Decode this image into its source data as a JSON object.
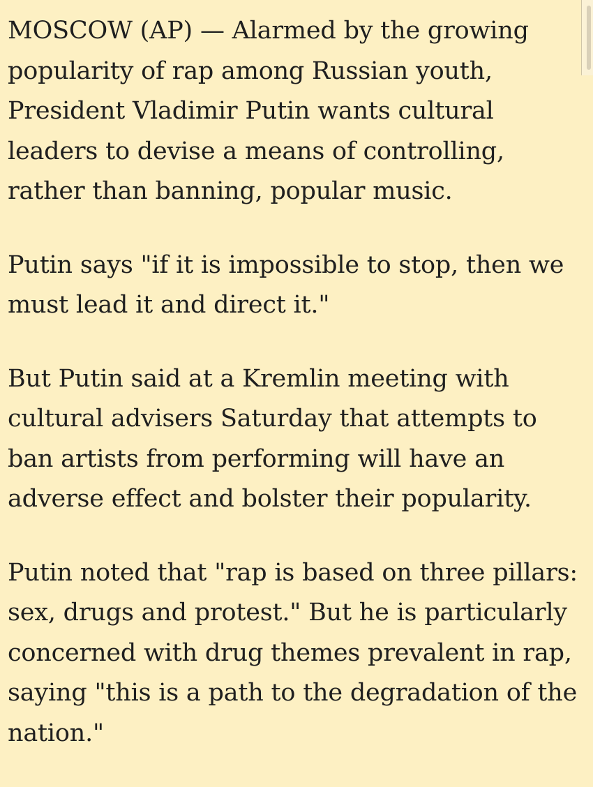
{
  "article": {
    "paragraphs": [
      {
        "lines": [
          "MOSCOW (AP) — Alarmed by the growing",
          "popularity of rap among Russian youth,",
          "President Vladimir Putin wants cultural",
          "leaders to devise a means of controlling,",
          "rather than banning, popular music."
        ]
      },
      {
        "lines": [
          "Putin says \"if it is impossible to stop, then we",
          "must lead it and direct it.\""
        ]
      },
      {
        "lines": [
          "But Putin said at a Kremlin meeting with",
          "cultural advisers Saturday that attempts to",
          "ban artists from performing will have an",
          "adverse effect and bolster their popularity."
        ]
      },
      {
        "lines": [
          "Putin noted that \"rap is based on three pillars:",
          "sex, drugs and protest.\" But he is particularly",
          "concerned with drug themes prevalent in rap,",
          "saying \"this is a path to the degradation of the",
          "nation.\""
        ]
      }
    ]
  },
  "colors": {
    "background": "#fdf0c3",
    "text": "#1f1f1f"
  }
}
